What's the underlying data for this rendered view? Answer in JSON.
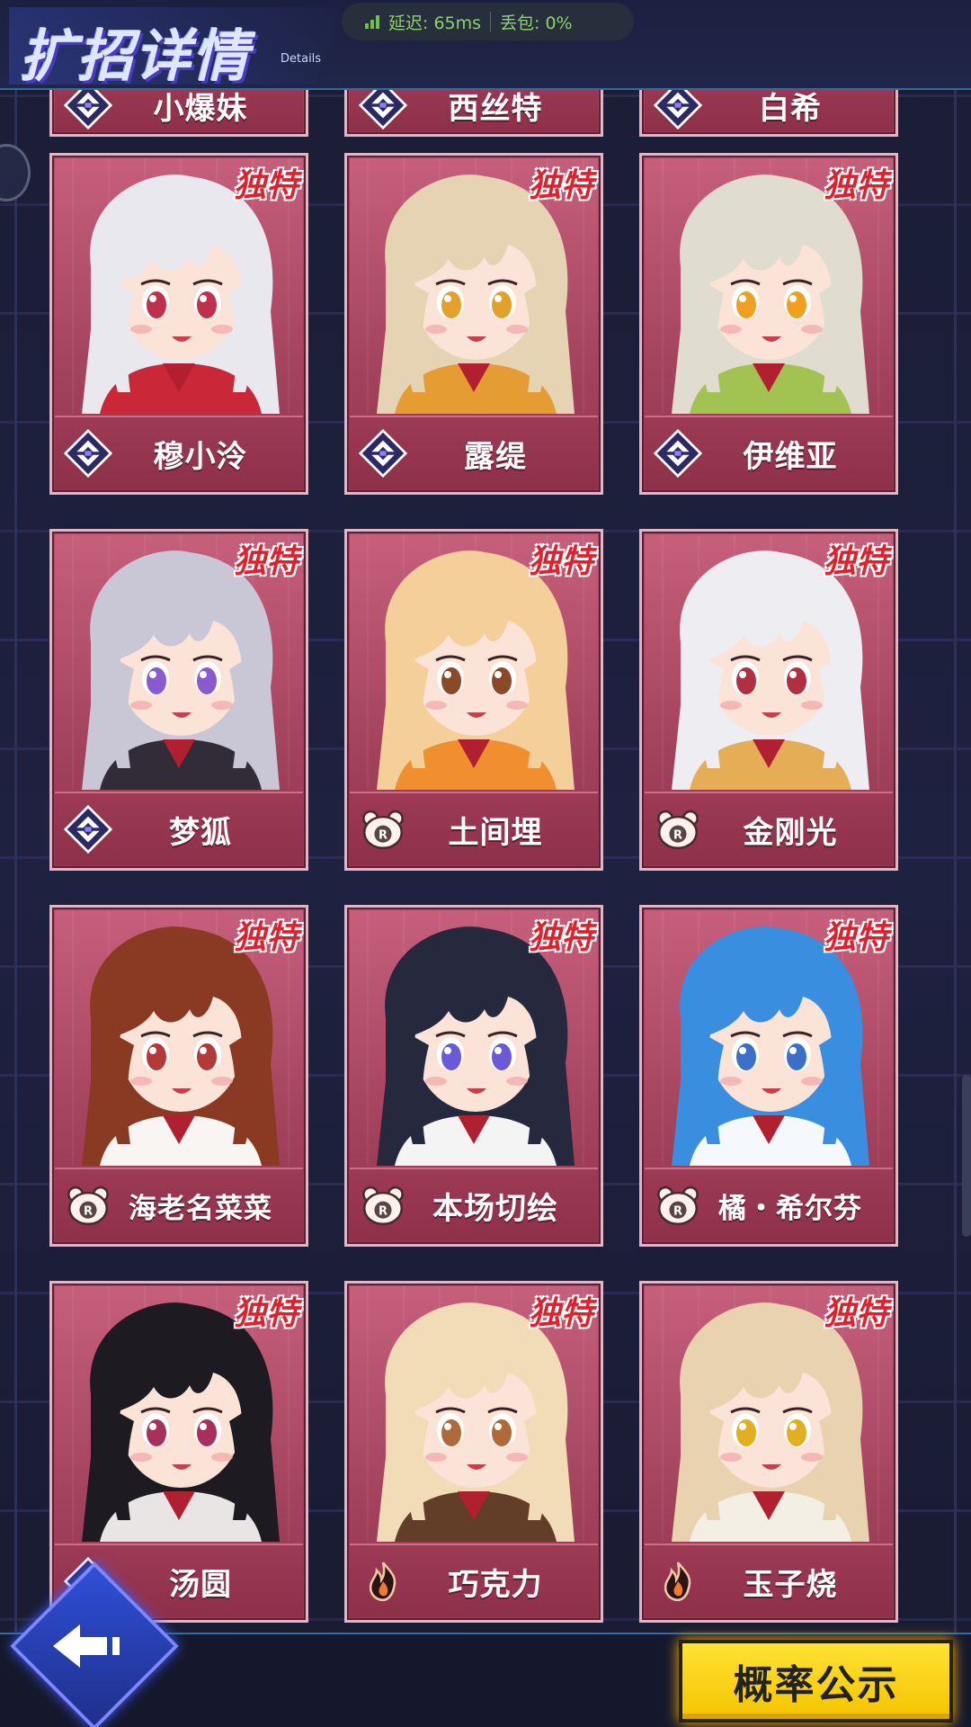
{
  "header": {
    "title": "扩招详情",
    "subtitle": "Details"
  },
  "network": {
    "latency_label": "延迟: 65ms",
    "loss_label": "丢包: 0%",
    "status_color": "#6cc24a"
  },
  "cards": [
    {
      "name": "小爆妹",
      "icon": "faction-diamond-icon",
      "unique": false,
      "partial": true
    },
    {
      "name": "西丝特",
      "icon": "faction-diamond-icon",
      "unique": false,
      "partial": true
    },
    {
      "name": "白希",
      "icon": "faction-diamond-icon",
      "unique": false,
      "partial": true
    },
    {
      "name": "穆小泠",
      "icon": "faction-diamond-icon",
      "unique": true,
      "hair": "#e8e8ee",
      "eye": "#c0304a",
      "accent": "#c81e2e"
    },
    {
      "name": "露缇",
      "icon": "faction-diamond-icon",
      "unique": true,
      "hair": "#e6d3b4",
      "eye": "#e3a02a",
      "accent": "#e59a2c"
    },
    {
      "name": "伊维亚",
      "icon": "faction-diamond-icon",
      "unique": true,
      "hair": "#e0dccf",
      "eye": "#f0a020",
      "accent": "#9ec04a"
    },
    {
      "name": "梦狐",
      "icon": "faction-diamond-icon",
      "unique": true,
      "hair": "#c9c6d6",
      "eye": "#8a5ad0",
      "accent": "#2a2430"
    },
    {
      "name": "土间埋",
      "icon": "bear-r-icon",
      "unique": true,
      "hair": "#f4cf9a",
      "eye": "#8a4a28",
      "accent": "#f08a2a"
    },
    {
      "name": "金刚光",
      "icon": "bear-r-icon",
      "unique": true,
      "hair": "#eeeef2",
      "eye": "#b03040",
      "accent": "#e4a94c"
    },
    {
      "name": "海老名菜菜",
      "icon": "bear-r-icon",
      "unique": true,
      "hair": "#8a3a22",
      "eye": "#b43a3a",
      "accent": "#ffffff"
    },
    {
      "name": "本场切绘",
      "icon": "bear-r-icon",
      "unique": true,
      "hair": "#26283e",
      "eye": "#6a5ad8",
      "accent": "#ffffff"
    },
    {
      "name": "橘・希尔芬",
      "icon": "bear-r-icon",
      "unique": true,
      "hair": "#3a8ee0",
      "eye": "#3a70c8",
      "accent": "#ffffff"
    },
    {
      "name": "汤圆",
      "icon": "faction-diamond-icon",
      "unique": true,
      "hair": "#1e1a22",
      "eye": "#a8305a",
      "accent": "#f4f0f0"
    },
    {
      "name": "巧克力",
      "icon": "flame-icon",
      "unique": true,
      "hair": "#f2dcb8",
      "eye": "#b06a3a",
      "accent": "#5a3420"
    },
    {
      "name": "玉子烧",
      "icon": "flame-icon",
      "unique": true,
      "hair": "#e8d2b0",
      "eye": "#e0b020",
      "accent": "#f4f0e8"
    }
  ],
  "unique_tag": "独特",
  "bottom": {
    "probability_button": "概率公示"
  },
  "colors": {
    "card_bg": "#b9465f",
    "card_border": "#e0b6c4",
    "unique_red": "#e0202c",
    "button_yellow": "#ffe233"
  }
}
